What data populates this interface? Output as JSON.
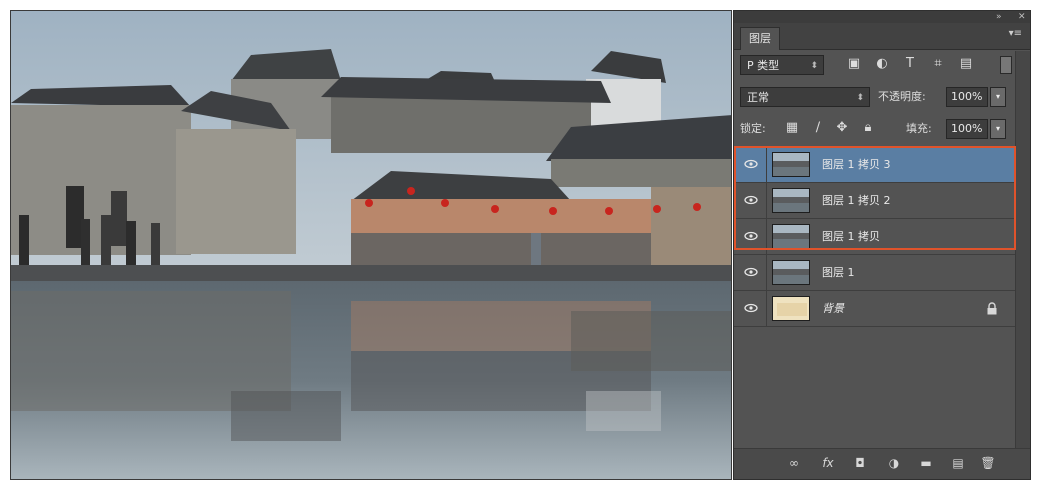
{
  "panel": {
    "tab_label": "图层",
    "filter_kind": "P 类型",
    "blend_mode": "正常",
    "opacity_label": "不透明度:",
    "opacity_value": "100%",
    "lock_label": "锁定:",
    "fill_label": "填充:",
    "fill_value": "100%"
  },
  "layers": [
    {
      "name": "图层 1 拷贝 3",
      "selected": true,
      "visible": true
    },
    {
      "name": "图层 1 拷贝 2",
      "selected": false,
      "visible": true
    },
    {
      "name": "图层 1 拷贝",
      "selected": false,
      "visible": true
    },
    {
      "name": "图层 1",
      "selected": false,
      "visible": true
    },
    {
      "name": "背景",
      "selected": false,
      "visible": true,
      "locked": true
    }
  ],
  "icons": {
    "filter": [
      "image-filter-icon",
      "adjustment-filter-icon",
      "type-filter-icon",
      "shape-filter-icon",
      "smart-object-filter-icon"
    ],
    "lock": [
      "lock-transparent-icon",
      "lock-paint-icon",
      "lock-move-icon",
      "lock-all-icon"
    ],
    "bottom": [
      "link-layers-icon",
      "fx-icon",
      "mask-icon",
      "adjustment-layer-icon",
      "group-folder-icon",
      "new-layer-icon",
      "trash-icon"
    ]
  },
  "colors": {
    "panel_bg": "#535353",
    "selected_row": "#5a7ea3",
    "highlight_border": "#e0532b"
  }
}
